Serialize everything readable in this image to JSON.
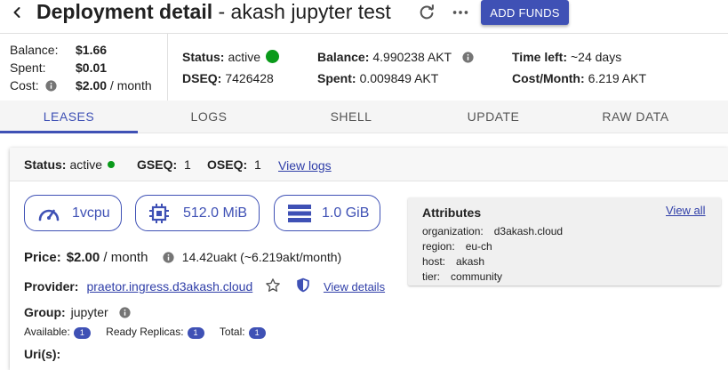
{
  "header": {
    "title_bold": "Deployment detail",
    "title_rest": " - akash jupyter test",
    "add_funds_label": "ADD FUNDS",
    "icons": [
      "chevron-left-icon",
      "refresh-icon",
      "more-horiz-icon"
    ]
  },
  "escrow": {
    "balance_label": "Balance:",
    "balance_value": "$1.66",
    "spent_label": "Spent:",
    "spent_value": "$0.01",
    "cost_label": "Cost:",
    "cost_value": "$2.00",
    "cost_unit": " / month"
  },
  "stats": {
    "status_label": "Status:",
    "status_value": "active",
    "dseq_label": "DSEQ:",
    "dseq_value": "7426428",
    "balance_label": "Balance:",
    "balance_value": "4.990238 AKT",
    "spent_label": "Spent:",
    "spent_value": "0.009849 AKT",
    "time_left_label": "Time left:",
    "time_left_value": "~24 days",
    "cost_month_label": "Cost/Month:",
    "cost_month_value": "6.219 AKT",
    "status_color": "#0a9a1a"
  },
  "tabs": [
    {
      "label": "LEASES",
      "active": true
    },
    {
      "label": "LOGS",
      "active": false
    },
    {
      "label": "SHELL",
      "active": false
    },
    {
      "label": "UPDATE",
      "active": false
    },
    {
      "label": "RAW DATA",
      "active": false
    }
  ],
  "lease": {
    "status_label": "Status:",
    "status_value": "active",
    "gseq_label": "GSEQ:",
    "gseq_value": "1",
    "oseq_label": "OSEQ:",
    "oseq_value": "1",
    "view_logs_label": "View logs",
    "resources": {
      "cpu": "1vcpu",
      "memory": "512.0 MiB",
      "storage": "1.0 GiB"
    },
    "price_label": "Price:",
    "price_value": "$2.00",
    "price_unit": " / month",
    "price_detail": "14.42uakt (~6.219akt/month)",
    "provider_label": "Provider:",
    "provider_value": "praetor.ingress.d3akash.cloud",
    "view_details_label": "View details",
    "group_label": "Group:",
    "group_value": "jupyter",
    "available_label": "Available:",
    "available_value": "1",
    "ready_label": "Ready Replicas:",
    "ready_value": "1",
    "total_label": "Total:",
    "total_value": "1",
    "uris_label": "Uri(s):"
  },
  "attributes": {
    "title": "Attributes",
    "view_all_label": "View all",
    "items": [
      {
        "key": "organization:",
        "value": "d3akash.cloud"
      },
      {
        "key": "region:",
        "value": "eu-ch"
      },
      {
        "key": "host:",
        "value": "akash"
      },
      {
        "key": "tier:",
        "value": "community"
      }
    ]
  },
  "colors": {
    "primary": "#3f51b5",
    "active_green": "#0a9a1a"
  }
}
